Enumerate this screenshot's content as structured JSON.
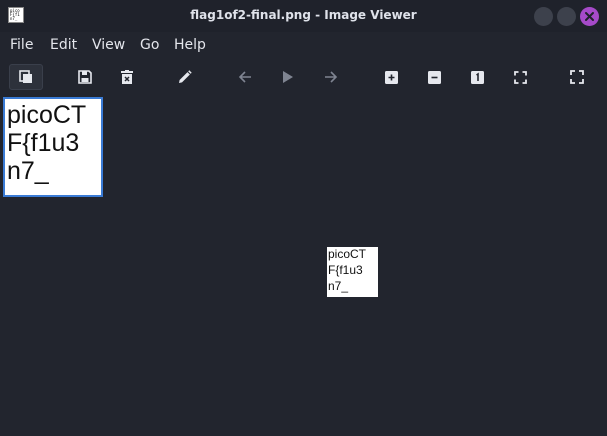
{
  "window": {
    "title": "flag1of2-final.png - Image Viewer",
    "app_icon_text": "pico\nF{f1\nn7_",
    "close_color": "#a64ac9"
  },
  "menu": {
    "items": [
      "File",
      "Edit",
      "View",
      "Go",
      "Help"
    ]
  },
  "toolbar": {
    "icons": [
      "image-gallery-icon",
      "save-icon",
      "delete-icon",
      "edit-icon",
      "back-arrow-icon",
      "play-icon",
      "forward-arrow-icon",
      "zoom-in-icon",
      "zoom-out-icon",
      "original-size-icon",
      "fit-window-icon",
      "fullscreen-icon"
    ]
  },
  "thumbnail": {
    "lines": [
      "picoCT",
      "F{f1u3",
      "n7_"
    ],
    "border_color": "#3a7bd5"
  },
  "image": {
    "lines": [
      "picoCT",
      "F{f1u3",
      "n7_"
    ]
  }
}
